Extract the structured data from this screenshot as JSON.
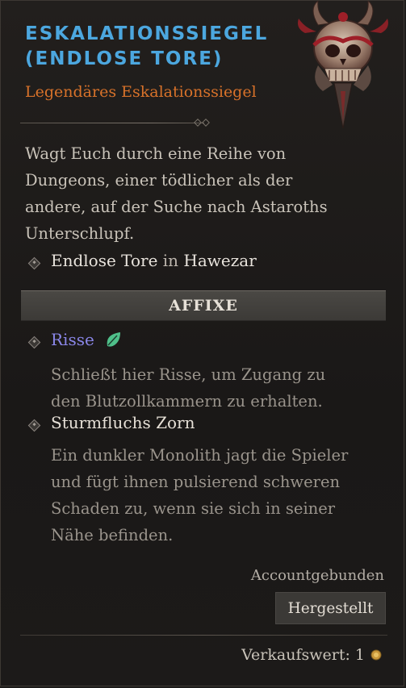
{
  "item": {
    "title_line1": "ESKALATIONSSIEGEL",
    "title_line2": "(ENDLOSE TORE)",
    "subtitle": "Legendäres Eskalationssiegel",
    "description": [
      "Wagt Euch durch eine Reihe von",
      "Dungeons, einer tödlicher als der",
      "andere, auf der Suche nach Astaroths",
      "Unterschlupf."
    ],
    "location": {
      "dungeon": "Endlose Tore",
      "preposition": "in",
      "region": "Hawezar"
    }
  },
  "affixes": {
    "header": "AFFIXE",
    "list": [
      {
        "name": "Risse",
        "name_color": "#8a86e8",
        "icon": "leaf-icon",
        "description": [
          "Schließt hier Risse, um Zugang zu",
          "den Blutzollkammern zu erhalten."
        ]
      },
      {
        "name": "Sturmfluchs Zorn",
        "name_color": "#e6e0d7",
        "description": [
          "Ein dunkler Monolith jagt die Spieler",
          "und fügt ihnen pulsierend schweren",
          "Schaden zu, wenn sie sich in seiner",
          "Nähe befinden."
        ]
      }
    ]
  },
  "footer": {
    "bound": "Accountgebunden",
    "crafted_button": "Hergestellt",
    "sell_label": "Verkaufswert: 1",
    "sell_icon": "gold-coin-icon"
  },
  "colors": {
    "title": "#4ca7df",
    "subtitle": "#d8722a",
    "leaf": "#4fc08a"
  }
}
